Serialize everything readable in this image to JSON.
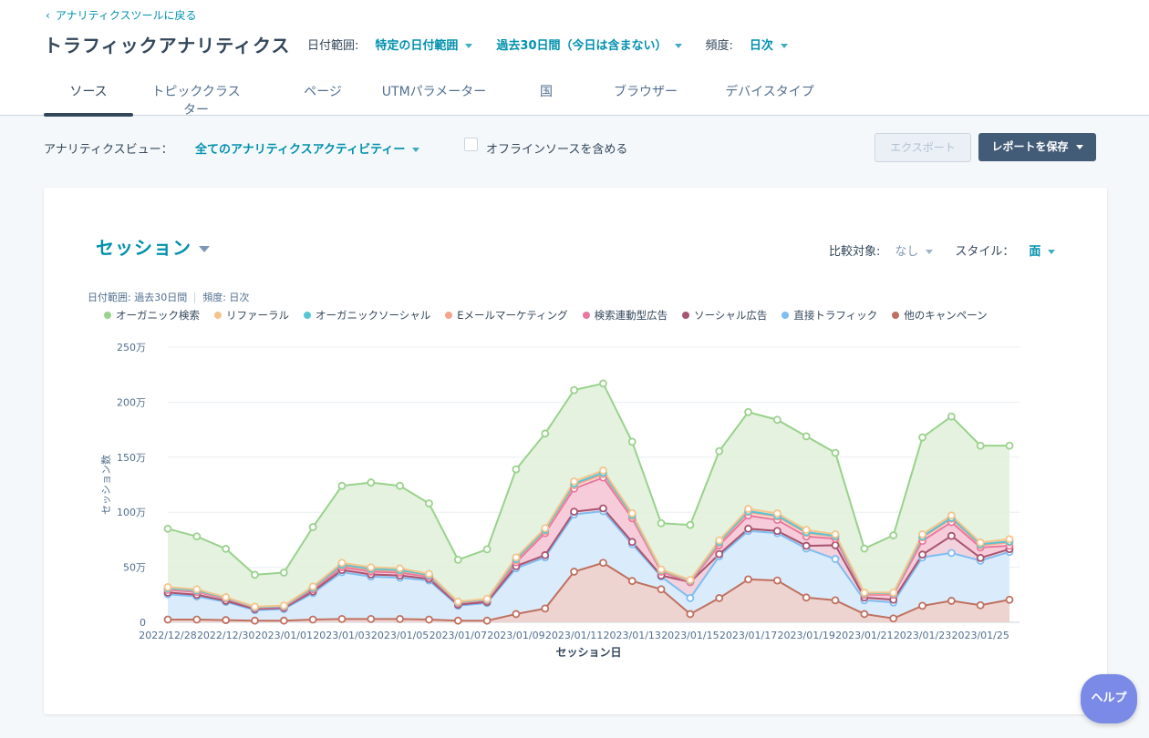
{
  "header": {
    "back_link": "アナリティクスツールに戻る",
    "title": "トラフィックアナリティクス",
    "date_range_label": "日付範囲:",
    "date_range_type": "特定の日付範囲",
    "date_range_value": "過去30日間（今日は含まない）",
    "frequency_label": "頻度:",
    "frequency_value": "日次"
  },
  "tabs": [
    {
      "label": "ソース",
      "active": true
    },
    {
      "label": "トピッククラスター",
      "active": false
    },
    {
      "label": "ページ",
      "active": false
    },
    {
      "label": "UTMパラメーター",
      "active": false
    },
    {
      "label": "国",
      "active": false
    },
    {
      "label": "ブラウザー",
      "active": false
    },
    {
      "label": "デバイスタイプ",
      "active": false
    }
  ],
  "toolbar": {
    "view_label": "アナリティクスビュー：",
    "view_value": "全てのアナリティクスアクティビティー",
    "offline_label": "オフラインソースを含める",
    "offline_checked": false,
    "export_label": "エクスポート",
    "save_label": "レポートを保存"
  },
  "chart_header": {
    "metric": "セッション",
    "compare_label": "比較対象:",
    "compare_value": "なし",
    "style_label": "スタイル：",
    "style_value": "面",
    "meta_range": "日付範囲: 過去30日間",
    "meta_freq": "頻度: 日次"
  },
  "colors": {
    "accent": "#0091ae",
    "save_button": "#425b76",
    "help_button": "#7a8ae6"
  },
  "help_label": "ヘルプ",
  "chart_data": {
    "type": "area",
    "stacked": true,
    "xlabel": "セッション日",
    "ylabel": "セッション数",
    "ylim": [
      0,
      2500000
    ],
    "yticks": [
      0,
      500000,
      1000000,
      1500000,
      2000000,
      2500000
    ],
    "ytick_labels": [
      "0",
      "50万",
      "100万",
      "150万",
      "200万",
      "250万"
    ],
    "x": [
      "2022/12/28",
      "2022/12/29",
      "2022/12/30",
      "2022/12/31",
      "2023/01/01",
      "2023/01/02",
      "2023/01/03",
      "2023/01/04",
      "2023/01/05",
      "2023/01/06",
      "2023/01/07",
      "2023/01/08",
      "2023/01/09",
      "2023/01/10",
      "2023/01/11",
      "2023/01/12",
      "2023/01/13",
      "2023/01/14",
      "2023/01/15",
      "2023/01/16",
      "2023/01/17",
      "2023/01/18",
      "2023/01/19",
      "2023/01/20",
      "2023/01/21",
      "2023/01/22",
      "2023/01/23",
      "2023/01/24",
      "2023/01/25",
      "2023/01/26"
    ],
    "xtick_labels": [
      "2022/12/28",
      "2022/12/30",
      "2023/01/01",
      "2023/01/03",
      "2023/01/05",
      "2023/01/07",
      "2023/01/09",
      "2023/01/11",
      "2023/01/13",
      "2023/01/15",
      "2023/01/17",
      "2023/01/19",
      "2023/01/21",
      "2023/01/23",
      "2023/01/25"
    ],
    "legend_placement": "top-left",
    "grid": true,
    "series": [
      {
        "name": "他のキャンペーン",
        "color": "#c0705f",
        "fill": "#ebcfcb",
        "values": [
          25000,
          25000,
          20000,
          15000,
          15000,
          25000,
          30000,
          30000,
          30000,
          25000,
          15000,
          15000,
          75000,
          125000,
          460000,
          540000,
          375000,
          300000,
          75000,
          220000,
          390000,
          380000,
          225000,
          200000,
          75000,
          35000,
          150000,
          195000,
          155000,
          205000
        ]
      },
      {
        "name": "直接トラフィック",
        "color": "#7fbdf2",
        "fill": "#d6eafc",
        "values": [
          230000,
          210000,
          165000,
          95000,
          105000,
          240000,
          425000,
          385000,
          375000,
          355000,
          135000,
          160000,
          415000,
          465000,
          520000,
          470000,
          335000,
          115000,
          145000,
          380000,
          440000,
          430000,
          445000,
          375000,
          125000,
          145000,
          440000,
          435000,
          405000,
          435000
        ]
      },
      {
        "name": "ソーシャル広告",
        "color": "#a8546e",
        "fill": "#f0cdd9",
        "values": [
          15000,
          15000,
          10000,
          10000,
          10000,
          15000,
          20000,
          20000,
          20000,
          15000,
          10000,
          10000,
          20000,
          20000,
          25000,
          25000,
          20000,
          10000,
          145000,
          20000,
          20000,
          20000,
          25000,
          125000,
          25000,
          25000,
          25000,
          155000,
          25000,
          25000
        ]
      },
      {
        "name": "検索連動型広告",
        "color": "#e9769e",
        "fill": "#f5c7d6",
        "values": [
          25000,
          25000,
          20000,
          10000,
          10000,
          20000,
          25000,
          25000,
          25000,
          20000,
          15000,
          15000,
          35000,
          200000,
          210000,
          280000,
          215000,
          35000,
          0,
          80000,
          120000,
          100000,
          85000,
          60000,
          25000,
          45000,
          125000,
          125000,
          95000,
          30000
        ]
      },
      {
        "name": "Eメールマーケティング",
        "color": "#f5a58c",
        "fill": "#fbe0d5",
        "values": [
          10000,
          10000,
          5000,
          5000,
          5000,
          10000,
          15000,
          15000,
          15000,
          10000,
          5000,
          5000,
          20000,
          20000,
          30000,
          30000,
          20000,
          10000,
          10000,
          20000,
          30000,
          30000,
          30000,
          20000,
          10000,
          10000,
          30000,
          30000,
          20000,
          30000
        ]
      },
      {
        "name": "オーガニックソーシャル",
        "color": "#57c5d6",
        "fill": "#cdeef4",
        "values": [
          5000,
          5000,
          3000,
          2000,
          2000,
          5000,
          10000,
          10000,
          10000,
          5000,
          3000,
          3000,
          10000,
          10000,
          15000,
          15000,
          10000,
          5000,
          5000,
          10000,
          10000,
          10000,
          10000,
          5000,
          5000,
          5000,
          10000,
          10000,
          10000,
          10000
        ]
      },
      {
        "name": "リファーラル",
        "color": "#f5c48c",
        "fill": "#fbe7cf",
        "values": [
          10000,
          10000,
          5000,
          5000,
          5000,
          10000,
          15000,
          15000,
          15000,
          10000,
          5000,
          5000,
          15000,
          15000,
          20000,
          20000,
          15000,
          5000,
          5000,
          15000,
          20000,
          20000,
          20000,
          15000,
          5000,
          5000,
          20000,
          20000,
          15000,
          20000
        ]
      },
      {
        "name": "オーガニック検索",
        "color": "#99d28c",
        "fill": "#e1f1dc",
        "values": [
          530000,
          480000,
          440000,
          290000,
          300000,
          540000,
          700000,
          770000,
          750000,
          640000,
          380000,
          450000,
          800000,
          860000,
          830000,
          790000,
          650000,
          420000,
          500000,
          810000,
          880000,
          850000,
          850000,
          740000,
          400000,
          520000,
          880000,
          900000,
          880000,
          850000
        ]
      }
    ]
  }
}
